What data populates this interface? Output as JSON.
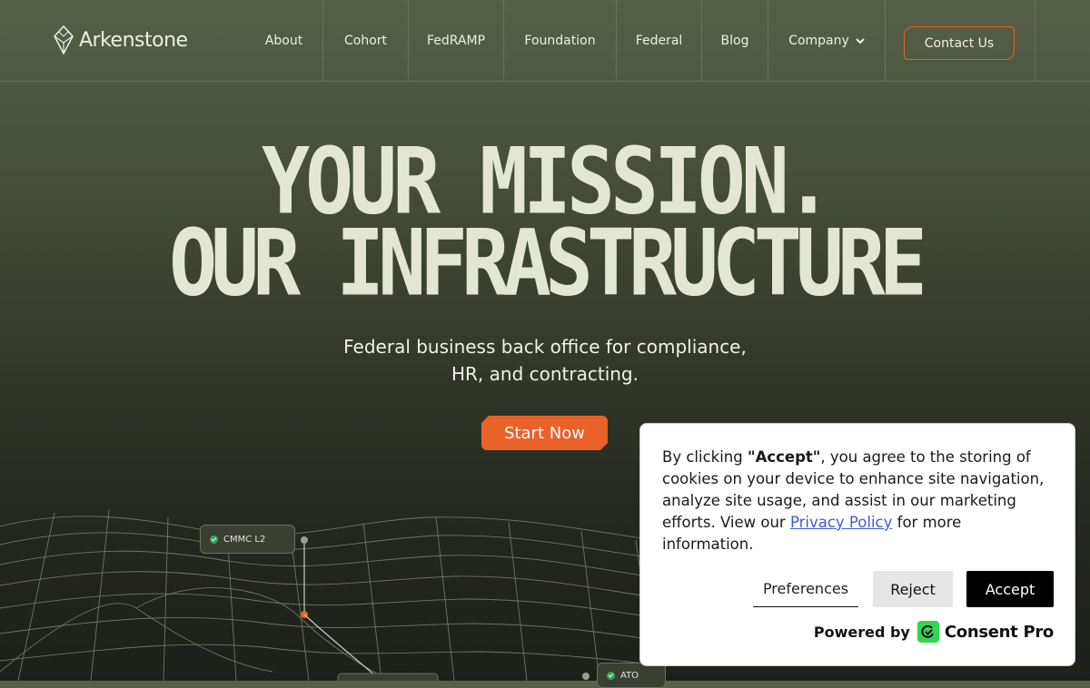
{
  "brand": {
    "name": "Arkenstone"
  },
  "nav": {
    "items": [
      {
        "label": "About"
      },
      {
        "label": "Cohort"
      },
      {
        "label": "FedRAMP"
      },
      {
        "label": "Foundation"
      },
      {
        "label": "Federal"
      },
      {
        "label": "Blog"
      },
      {
        "label": "Company",
        "icon": "chevron-down-icon"
      }
    ],
    "contact_label": "Contact Us"
  },
  "hero": {
    "title_line1": "YOUR MISSION.",
    "title_line2": "OUR INFRASTRUCTURE",
    "subtitle_line1": "Federal business back office for compliance,",
    "subtitle_line2": "HR, and contracting.",
    "cta_label": "Start Now"
  },
  "badges": [
    {
      "label": "CMMC L2",
      "icon": "check-circle-icon"
    },
    {
      "label": "ATO",
      "icon": "check-circle-icon"
    }
  ],
  "cookie": {
    "text_before": "By clicking ",
    "text_bold": "\"Accept\"",
    "text_middle": ", you agree to the storing of cookies on your device to enhance site navigation, analyze site usage, and assist in our marketing efforts. View our ",
    "link_label": "Privacy Policy",
    "text_after": " for more information.",
    "preferences_label": "Preferences",
    "reject_label": "Reject",
    "accept_label": "Accept",
    "powered_label": "Powered by",
    "provider_name": "Consent Pro"
  },
  "colors": {
    "accent": "#e8622a",
    "text_light": "#e3e6d6",
    "provider_green": "#35d455",
    "link": "#3f5bd6"
  }
}
